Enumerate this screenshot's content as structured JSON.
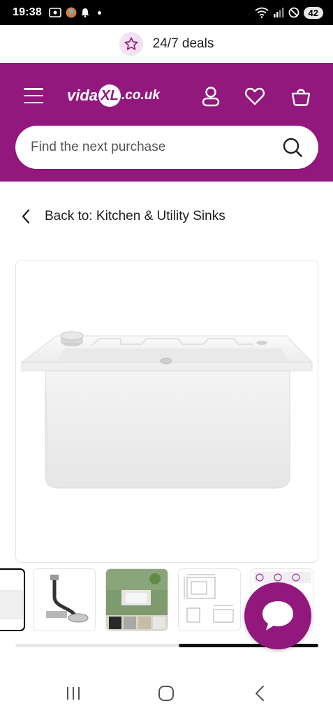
{
  "status_bar": {
    "time": "19:38",
    "battery": "42",
    "icons": [
      "screenshot-icon",
      "avatar-icon",
      "notification-bell-icon",
      "wifi-icon",
      "signal-icon",
      "dnd-icon"
    ]
  },
  "deals": {
    "text": "24/7 deals",
    "icon": "star-icon"
  },
  "header": {
    "logo_prefix": "vida",
    "logo_mark": "XL",
    "logo_suffix": ".co.uk",
    "brand_color": "#92187d"
  },
  "search": {
    "placeholder": "Find the next purchase"
  },
  "breadcrumb": {
    "text": "Back to: Kitchen & Utility Sinks"
  },
  "gallery": {
    "main_image": "white-granite-kitchen-sink",
    "thumbnails": [
      "sink-angle-view",
      "drain-waste-kit",
      "sink-installed-kitchen-with-colour-swatches",
      "dimension-drawing",
      "feature-infographic"
    ]
  },
  "colors": {
    "accent": "#92187d",
    "scrollbar": "#111111"
  }
}
